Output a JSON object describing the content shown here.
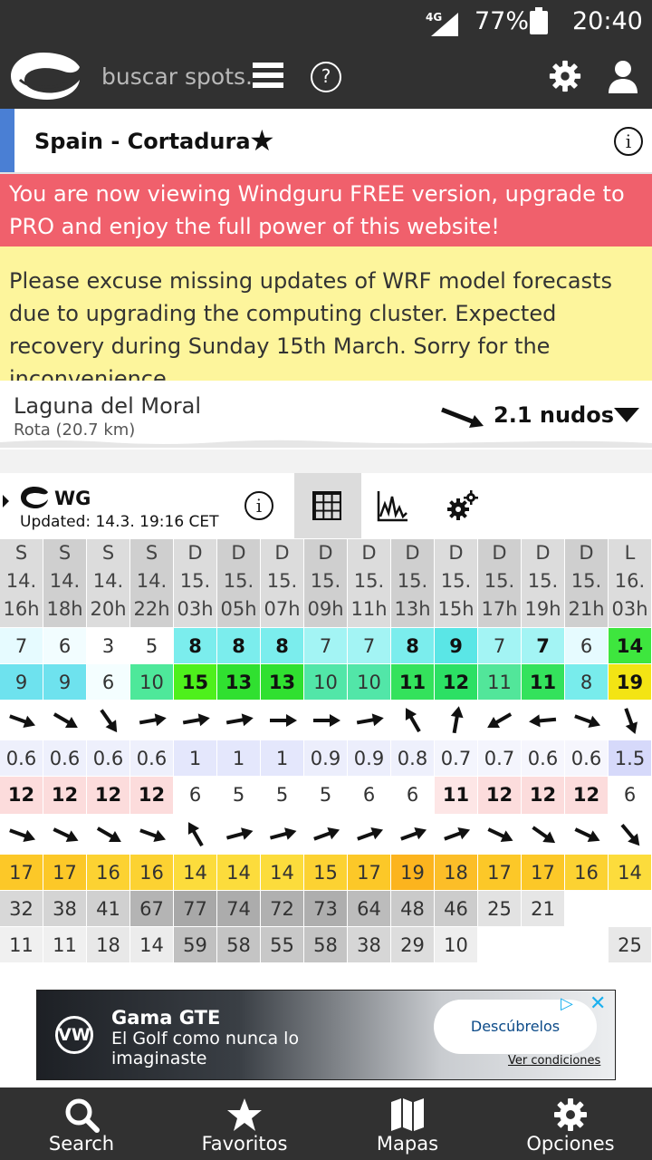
{
  "status_bar": {
    "network": "4G",
    "battery": "77%",
    "time": "20:40"
  },
  "header": {
    "search_placeholder": "buscar spots.",
    "help_symbol": "?"
  },
  "spot": {
    "title": "Spain - Cortadura",
    "info_symbol": "i"
  },
  "free_banner": "You are now viewing Windguru FREE version, upgrade to PRO and enjoy the full power of this website!",
  "notice": "Please excuse missing updates of WRF model forecasts due to upgrading the computing cluster. Expected recovery during Sunday 15th March. Sorry for the inconvenience.",
  "station": {
    "name": "Laguna del Moral",
    "location": "Rota  (20.7 km)",
    "wind": "2.1 nudos"
  },
  "model": {
    "name": "WG",
    "updated": "Updated: 14.3. 19:16 CET",
    "info_symbol": "i"
  },
  "forecast": {
    "days": [
      "S",
      "S",
      "S",
      "S",
      "D",
      "D",
      "D",
      "D",
      "D",
      "D",
      "D",
      "D",
      "D",
      "D",
      "L"
    ],
    "dates": [
      "14.",
      "14.",
      "14.",
      "14.",
      "15.",
      "15.",
      "15.",
      "15.",
      "15.",
      "15.",
      "15.",
      "15.",
      "15.",
      "15.",
      "16."
    ],
    "hours": [
      "16h",
      "18h",
      "20h",
      "22h",
      "03h",
      "05h",
      "07h",
      "09h",
      "11h",
      "13h",
      "15h",
      "17h",
      "19h",
      "21h",
      "03h"
    ],
    "wind_speed": [
      "7",
      "6",
      "3",
      "5",
      "8",
      "8",
      "8",
      "7",
      "7",
      "8",
      "9",
      "7",
      "7",
      "6",
      "14"
    ],
    "wind_gusts": [
      "9",
      "9",
      "6",
      "10",
      "15",
      "13",
      "13",
      "10",
      "10",
      "11",
      "12",
      "11",
      "11",
      "8",
      "19"
    ],
    "wind_dir_deg": [
      110,
      120,
      145,
      80,
      80,
      80,
      90,
      90,
      80,
      330,
      10,
      240,
      265,
      110,
      160
    ],
    "wave_height": [
      "0.6",
      "0.6",
      "0.6",
      "0.6",
      "1",
      "1",
      "1",
      "0.9",
      "0.9",
      "0.8",
      "0.7",
      "0.7",
      "0.6",
      "0.6",
      "1.5"
    ],
    "wave_period": [
      "12",
      "12",
      "12",
      "12",
      "6",
      "5",
      "5",
      "5",
      "6",
      "6",
      "11",
      "12",
      "12",
      "12",
      "6"
    ],
    "wave_dir_deg": [
      110,
      115,
      120,
      110,
      330,
      75,
      75,
      70,
      70,
      70,
      70,
      115,
      125,
      115,
      140
    ],
    "temperature": [
      "17",
      "17",
      "16",
      "16",
      "14",
      "14",
      "14",
      "15",
      "17",
      "19",
      "18",
      "17",
      "17",
      "16",
      "14"
    ],
    "cloud_cover": [
      "32",
      "38",
      "41",
      "67",
      "77",
      "74",
      "72",
      "73",
      "64",
      "48",
      "46",
      "25",
      "21",
      "",
      ""
    ],
    "rain": [
      "11",
      "11",
      "18",
      "14",
      "59",
      "58",
      "55",
      "58",
      "38",
      "29",
      "10",
      "",
      "",
      "",
      "25"
    ]
  },
  "colors": {
    "ws": [
      "#e6fbff",
      "#f2fdff",
      "#ffffff",
      "#ffffff",
      "#7beded",
      "#7beded",
      "#7beded",
      "#a3f4f4",
      "#a3f4f4",
      "#7beded",
      "#5ae6e6",
      "#a3f4f4",
      "#a3f4f4",
      "#e6fbff",
      "#3ee63e"
    ],
    "wg": [
      "#6ee2ee",
      "#6ee2ee",
      "#f4feff",
      "#4ee89a",
      "#4ef01c",
      "#30e030",
      "#30e030",
      "#52e6a8",
      "#52e6a8",
      "#34e25c",
      "#2ce064",
      "#52e69a",
      "#34e25c",
      "#78ecec",
      "#f3e414"
    ],
    "wh": [
      "#eef0fc",
      "#eef0fc",
      "#eef0fc",
      "#eef0fc",
      "#e4e7fc",
      "#e4e7fc",
      "#e4e7fc",
      "#eceefc",
      "#eceefc",
      "#eef0fc",
      "#f4f5fd",
      "#f4f5fd",
      "#f6f6fd",
      "#f6f6fd",
      "#d6d9fa"
    ],
    "wp": [
      "#fcdcdc",
      "#fcdcdc",
      "#fcdcdc",
      "#fcdcdc",
      "#ffffff",
      "#ffffff",
      "#ffffff",
      "#ffffff",
      "#ffffff",
      "#ffffff",
      "#fde6e6",
      "#fcdcdc",
      "#fcdcdc",
      "#fcdcdc",
      "#ffffff"
    ],
    "temp": [
      "#fcc828",
      "#fcc828",
      "#fcd232",
      "#fcd232",
      "#fcdc3c",
      "#fcdc3c",
      "#fcdc3c",
      "#fcd232",
      "#fcc828",
      "#fcb41e",
      "#fcbe28",
      "#fcc828",
      "#fcc828",
      "#fcd232",
      "#fcdc3c"
    ],
    "cloud": [
      "#d8d8d8",
      "#d4d4d4",
      "#d0d0d0",
      "#b4b4b4",
      "#a8a8a8",
      "#acacac",
      "#b0b0b0",
      "#aeaeae",
      "#bcbcbc",
      "#cacaca",
      "#cccccc",
      "#e2e2e2",
      "#e6e6e6",
      "#ffffff",
      "#ffffff"
    ],
    "rain": [
      "#f0f0f0",
      "#f0f0f0",
      "#e8e8e8",
      "#ececec",
      "#c0c0c0",
      "#c4c4c4",
      "#c8c8c8",
      "#c4c4c4",
      "#d6d6d6",
      "#dddddd",
      "#eeeeee",
      "#ffffff",
      "#ffffff",
      "#ffffff",
      "#e8e8e8"
    ]
  },
  "ad": {
    "title": "Gama GTE",
    "text": "El Golf como nunca lo imaginaste",
    "cta": "Descúbrelos",
    "conditions": "Ver condiciones",
    "brand": "VW",
    "choices_symbol": "▷",
    "close_symbol": "✕"
  },
  "nav": [
    {
      "label": "Search",
      "icon": "search-icon"
    },
    {
      "label": "Favoritos",
      "icon": "star-icon"
    },
    {
      "label": "Mapas",
      "icon": "map-icon"
    },
    {
      "label": "Opciones",
      "icon": "gear-icon"
    }
  ]
}
